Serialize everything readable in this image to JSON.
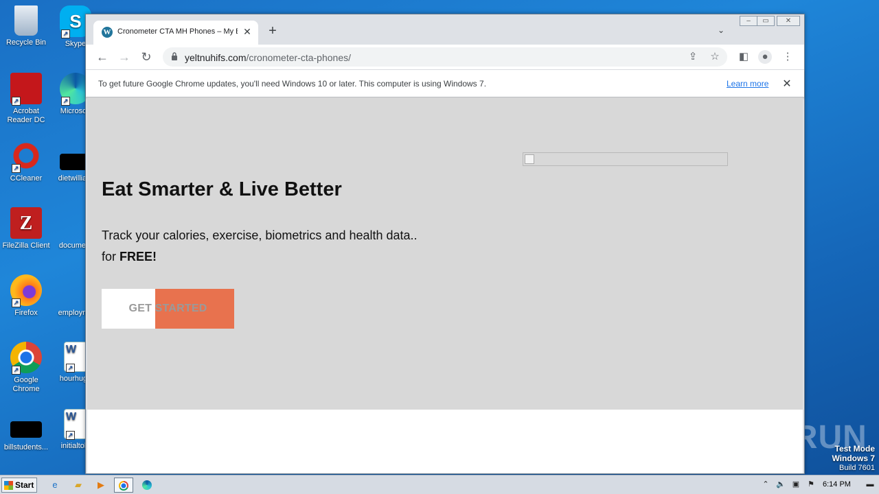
{
  "desktop": {
    "icons": [
      {
        "label": "Recycle Bin",
        "icon": "recycle-bin-icon"
      },
      {
        "label": "Skype",
        "icon": "skype-icon"
      },
      {
        "label": "Acrobat Reader DC",
        "icon": "acrobat-icon"
      },
      {
        "label": "Microsoft",
        "icon": "edge-icon"
      },
      {
        "label": "CCleaner",
        "icon": "ccleaner-icon"
      },
      {
        "label": "dietwilliam",
        "icon": "file-icon"
      },
      {
        "label": "FileZilla Client",
        "icon": "filezilla-icon"
      },
      {
        "label": "document",
        "icon": "file-icon"
      },
      {
        "label": "Firefox",
        "icon": "firefox-icon"
      },
      {
        "label": "employme",
        "icon": "file-icon"
      },
      {
        "label": "Google Chrome",
        "icon": "chrome-icon"
      },
      {
        "label": "hourhuge",
        "icon": "word-doc-icon"
      },
      {
        "label": "billstudents...",
        "icon": "file-icon"
      },
      {
        "label": "initialtold",
        "icon": "word-doc-icon"
      }
    ]
  },
  "browser": {
    "tab_title": "Cronometer CTA MH Phones – My Bl",
    "url_host": "yeltnuhifs.com",
    "url_path": "/cronometer-cta-phones/",
    "infobar_message": "To get future Google Chrome updates, you'll need Windows 10 or later. This computer is using Windows 7.",
    "infobar_link": "Learn more"
  },
  "page": {
    "headline": "Eat Smarter & Live Better",
    "subline1": "Track your calories, exercise, biometrics and health data..",
    "subline2_prefix": "for ",
    "subline2_bold": "FREE!",
    "cta_label": "GET STARTED",
    "colors": {
      "cta": "#e8724e",
      "hero_bg": "#d8d8d8"
    }
  },
  "watermark": "ANY RUN",
  "system": {
    "testmode_line1": "Test Mode",
    "testmode_line2": "Windows 7",
    "testmode_line3": "Build 7601",
    "start_label": "Start",
    "clock": "6:14 PM"
  }
}
